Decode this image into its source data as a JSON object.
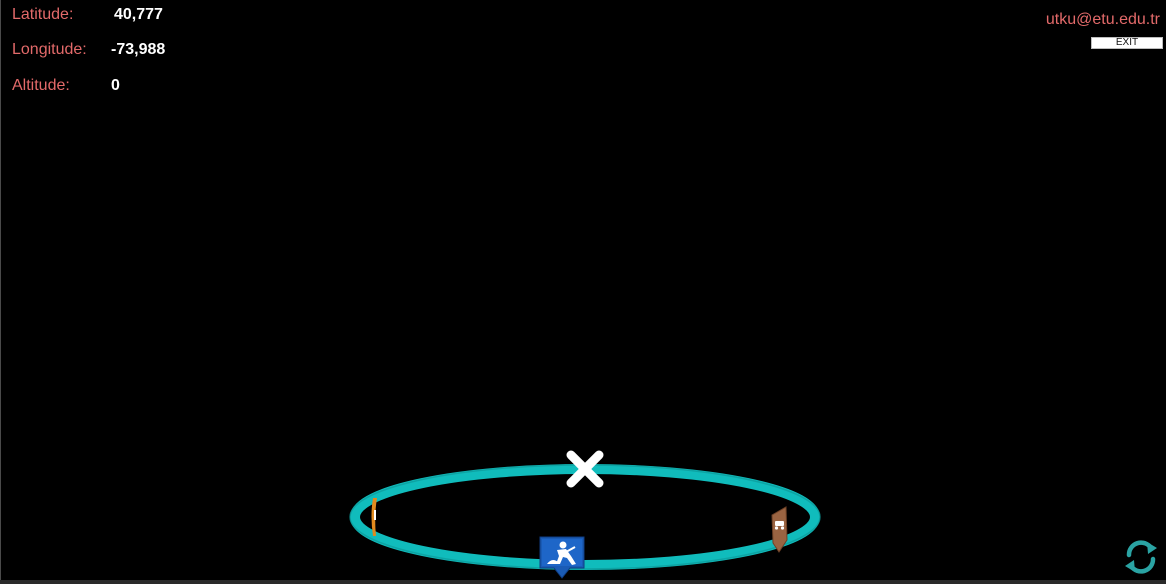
{
  "hud": {
    "latitude": {
      "label": "Latitude:",
      "value": "40,777"
    },
    "longitude": {
      "label": "Longitude:",
      "value": "-73,988"
    },
    "altitude": {
      "label": "Altitude:",
      "value": "0"
    }
  },
  "user": {
    "email": "utku@etu.edu.tr",
    "exit_label": "EXIT"
  },
  "ar_view": {
    "ring_color": "#10bcbc",
    "icons": [
      "close-icon",
      "construction-marker-icon",
      "vehicle-marker-icon",
      "orange-marker-icon",
      "refresh-icon"
    ]
  },
  "colors": {
    "label": "#e36a6a",
    "value": "#ffffff",
    "background": "#000000",
    "construction_marker": "#1a5bb5",
    "vehicle_marker": "#9a6442",
    "refresh": "#2aa3a3"
  }
}
